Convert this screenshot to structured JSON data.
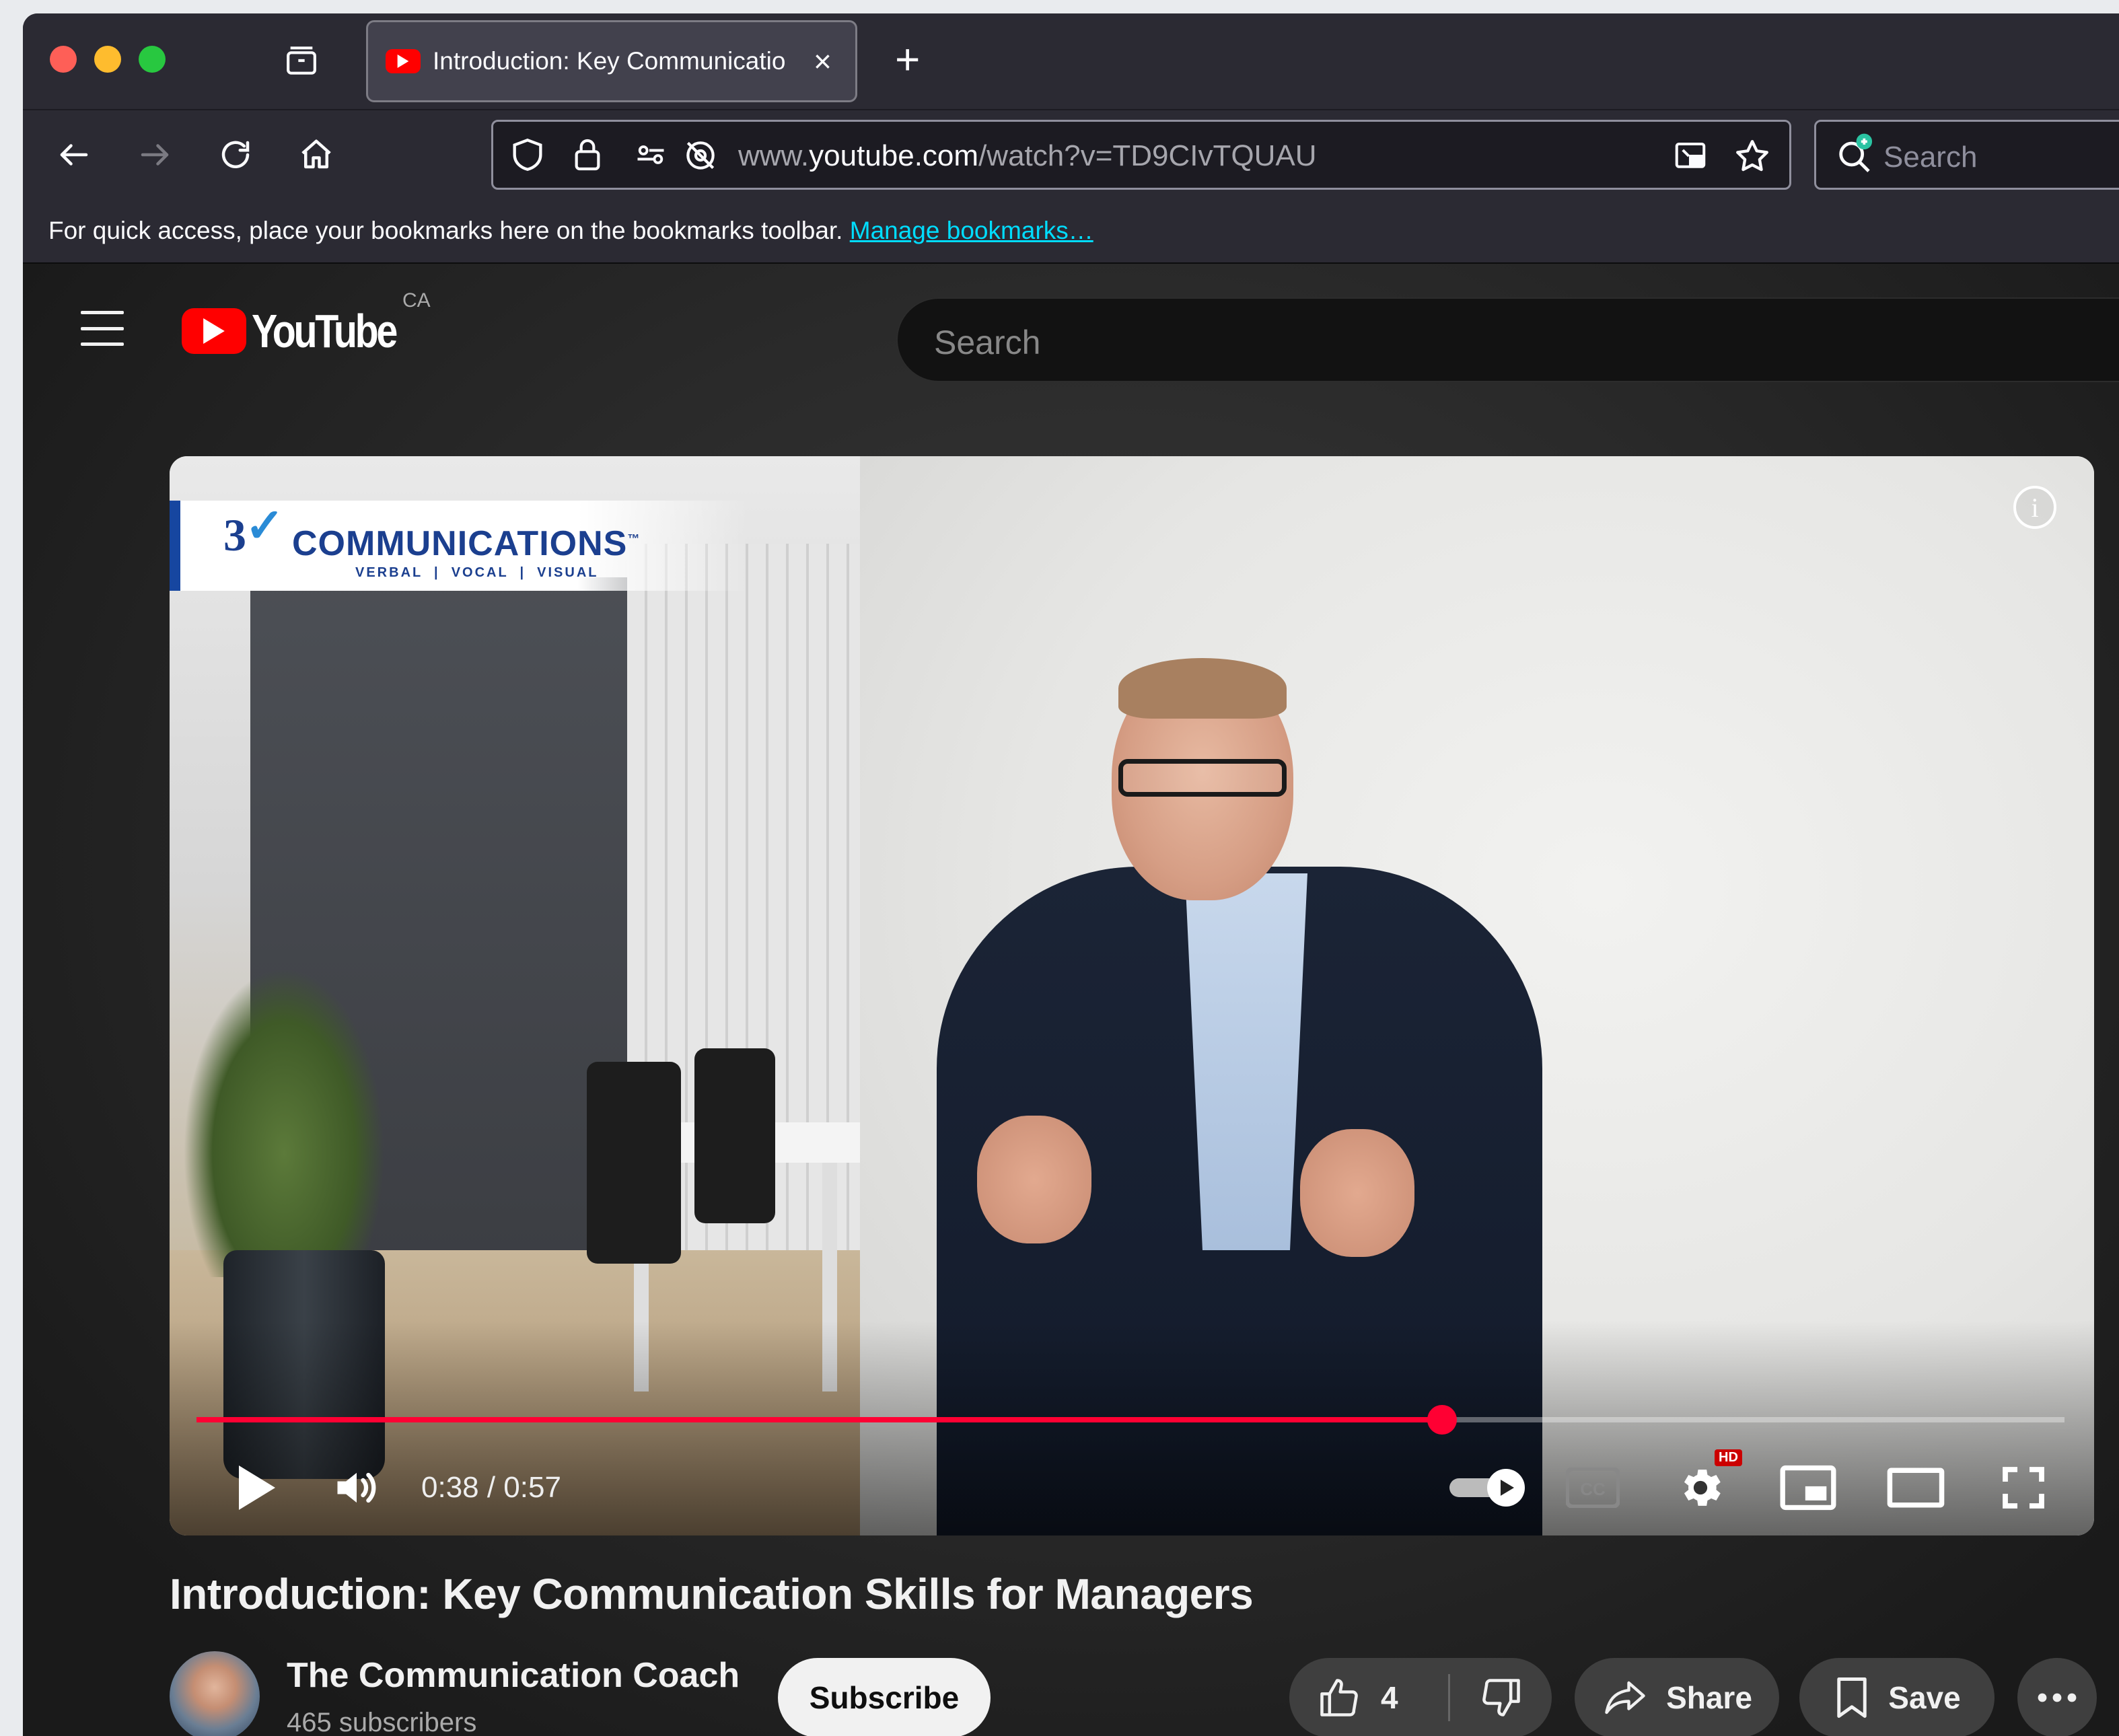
{
  "browser": {
    "tab": {
      "title": "Introduction: Key Communicatio",
      "close_icon": "×"
    },
    "new_tab_icon": "+",
    "url": {
      "prefix": "www.",
      "domain": "youtube.com",
      "path": "/watch?v=TD9CIvTQUAU"
    },
    "search_placeholder": "Search",
    "bookmarks_bar": {
      "text": "For quick access, place your bookmarks here on the bookmarks toolbar.",
      "link": "Manage bookmarks…"
    }
  },
  "youtube": {
    "logo_text": "YouTube",
    "country_code": "CA",
    "search_placeholder": "Search",
    "player": {
      "brand_mark": "3",
      "brand_name": "COMMUNICATIONS",
      "brand_tm": "™",
      "brand_tagline": "VERBAL  |  VOCAL  |  VISUAL",
      "info_icon": "i",
      "time": "0:38 / 0:57",
      "progress_fraction": 0.6667,
      "hd_badge": "HD",
      "autoplay": true
    },
    "video": {
      "title": "Introduction: Key Communication Skills for Managers",
      "channel": "The Communication Coach",
      "subscribers": "465 subscribers",
      "subscribe_label": "Subscribe",
      "likes": "4",
      "share_label": "Share",
      "save_label": "Save"
    }
  },
  "colors": {
    "youtube_red": "#ff0000",
    "progress_red": "#ff0033",
    "browser_chrome": "#2b2a33",
    "link": "#00ddff"
  },
  "icons": [
    "tab-list-icon",
    "youtube-favicon",
    "back-arrow-icon",
    "forward-arrow-icon",
    "reload-icon",
    "home-icon",
    "shield-icon",
    "lock-icon",
    "permissions-icon",
    "tracking-blocked-icon",
    "picture-in-picture-icon",
    "bookmark-star-icon",
    "search-engine-icon",
    "hamburger-menu-icon",
    "info-icon",
    "play-icon",
    "volume-icon",
    "autoplay-toggle-icon",
    "captions-icon",
    "settings-gear-icon",
    "miniplayer-icon",
    "theater-mode-icon",
    "fullscreen-icon",
    "thumbs-up-icon",
    "thumbs-down-icon",
    "share-arrow-icon",
    "save-bookmark-icon",
    "more-dots-icon"
  ]
}
